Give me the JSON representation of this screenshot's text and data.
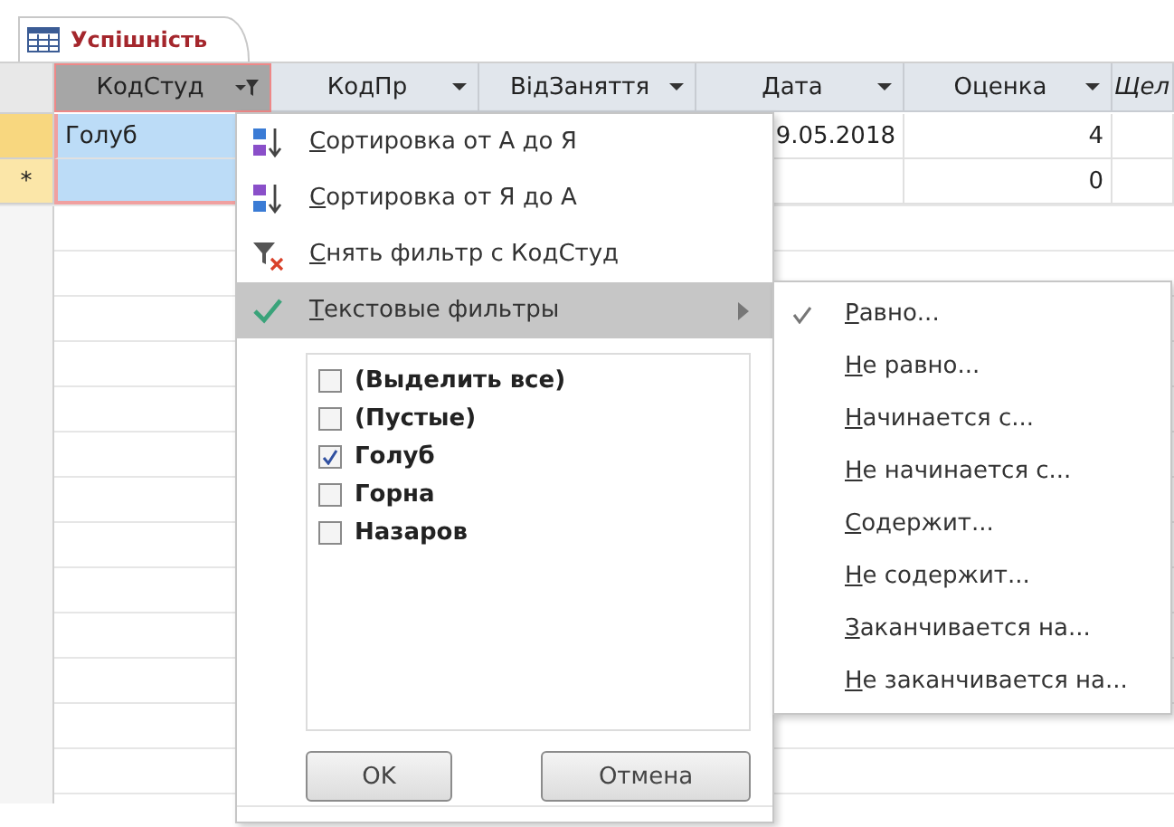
{
  "tab": {
    "title": "Успішність"
  },
  "columns": [
    {
      "label": "КодСтуд",
      "kind": "filtered",
      "selected": true
    },
    {
      "label": "КодПр",
      "kind": "dropdown",
      "selected": false
    },
    {
      "label": "ВідЗаняття",
      "kind": "dropdown",
      "selected": false
    },
    {
      "label": "Дата",
      "kind": "dropdown",
      "selected": false
    },
    {
      "label": "Оценка",
      "kind": "dropdown",
      "selected": false
    },
    {
      "label": "Щел",
      "kind": "partial",
      "selected": false
    }
  ],
  "rows": [
    {
      "kind": "current",
      "cells": [
        "Голуб",
        null,
        null,
        "9.05.2018",
        "4",
        null
      ]
    },
    {
      "kind": "new",
      "selector": "*",
      "cells": [
        null,
        null,
        null,
        null,
        "0",
        null
      ]
    }
  ],
  "filter_menu": {
    "items": [
      {
        "kind": "sort-asc",
        "label": "Сортировка от А до Я",
        "selected": false
      },
      {
        "kind": "sort-desc",
        "label": "Сортировка от Я до А",
        "selected": false
      },
      {
        "kind": "clear-filter",
        "label": "Снять фильтр с КодСтуд",
        "selected": false
      },
      {
        "kind": "submenu",
        "label": "Текстовые фильтры",
        "selected": true
      }
    ],
    "values": [
      {
        "label": "(Выделить все)",
        "checked": false
      },
      {
        "label": "(Пустые)",
        "checked": false
      },
      {
        "label": "Голуб",
        "checked": true
      },
      {
        "label": "Горна",
        "checked": false
      },
      {
        "label": "Назаров",
        "checked": false
      }
    ],
    "buttons": [
      "OK",
      "Отмена"
    ]
  },
  "text_filters": [
    {
      "label": "Равно...",
      "checked": true
    },
    {
      "label": "Не равно...",
      "checked": false
    },
    {
      "label": "Начинается с...",
      "checked": false
    },
    {
      "label": "Не начинается с...",
      "checked": false
    },
    {
      "label": "Содержит...",
      "checked": false
    },
    {
      "label": "Не содержит...",
      "checked": false
    },
    {
      "label": "Заканчивается на...",
      "checked": false
    },
    {
      "label": "Не заканчивается на...",
      "checked": false
    }
  ]
}
